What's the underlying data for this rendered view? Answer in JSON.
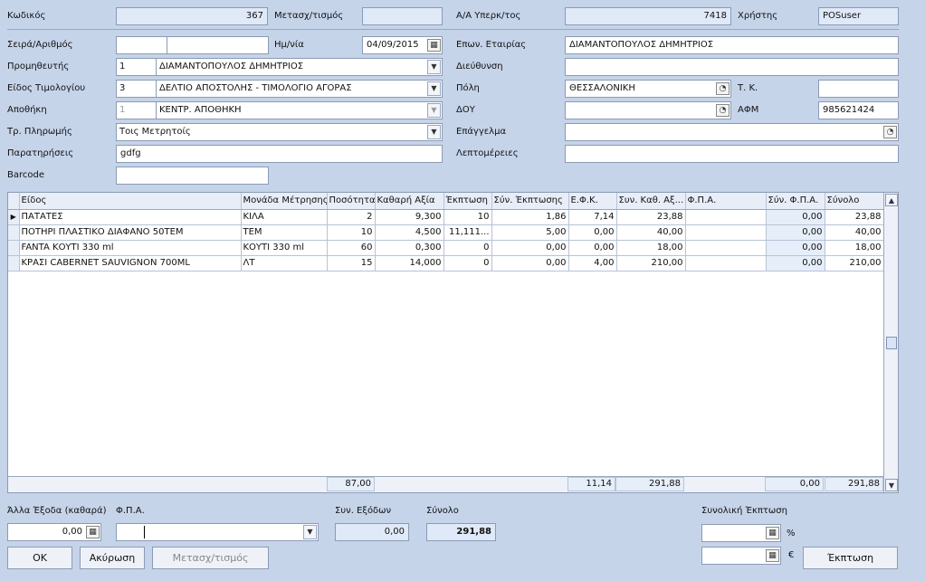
{
  "header": {
    "code_label": "Κωδικός",
    "code_value": "367",
    "transfer_label": "Μετασχ/τισμός",
    "transfer_value": "",
    "seq_label": "Α/Α Υπερκ/τος",
    "seq_value": "7418",
    "user_label": "Χρήστης",
    "user_value": "POSuser"
  },
  "form": {
    "series_label": "Σειρά/Αριθμός",
    "series_value": "",
    "number_value": "",
    "date_label": "Ημ/νία",
    "date_value": "04/09/2015",
    "supplier_label": "Προμηθευτής",
    "supplier_code": "1",
    "supplier_name": "ΔΙΑΜΑΝΤΟΠΟΥΛΟΣ ΔΗΜΗΤΡΙΟΣ",
    "invtype_label": "Είδος Τιμολογίου",
    "invtype_code": "3",
    "invtype_name": "ΔΕΛΤΙΟ ΑΠΟΣΤΟΛΗΣ - ΤΙΜΟΛΟΓΙΟ ΑΓΟΡΑΣ",
    "warehouse_label": "Αποθήκη",
    "warehouse_code": "1",
    "warehouse_name": "ΚΕΝΤΡ. ΑΠΟΘΗΚΗ",
    "payment_label": "Τρ. Πληρωμής",
    "payment_value": "Τοις Μετρητοίς",
    "notes_label": "Παρατηρήσεις",
    "notes_value": "gdfg",
    "barcode_label": "Barcode",
    "barcode_value": "",
    "company_label": "Επων. Εταιρίας",
    "company_value": "ΔΙΑΜΑΝΤΟΠΟΥΛΟΣ ΔΗΜΗΤΡΙΟΣ",
    "address_label": "Διεύθυνση",
    "address_value": "",
    "city_label": "Πόλη",
    "city_value": "ΘΕΣΣΑΛΟΝΙΚΗ",
    "zip_label": "Τ. Κ.",
    "zip_value": "",
    "doy_label": "ΔΟΥ",
    "doy_value": "",
    "afm_label": "ΑΦΜ",
    "afm_value": "985621424",
    "profession_label": "Επάγγελμα",
    "profession_value": "",
    "details_label": "Λεπτομέρειες",
    "details_value": ""
  },
  "grid": {
    "columns": [
      "Είδος",
      "Μονάδα Μέτρησης",
      "Ποσότητα",
      "Καθαρή Αξία",
      "Έκπτωση",
      "Σύν. Έκπτωσης",
      "Ε.Φ.Κ.",
      "Συν. Καθ. Αξ...",
      "Φ.Π.Α.",
      "Σύν. Φ.Π.Α.",
      "Σύνολο"
    ],
    "rows": [
      {
        "item": "ΠΑΤΑΤΕΣ",
        "unit": "ΚΙΛΑ",
        "qty": "2",
        "net": "9,300",
        "disc": "10",
        "discsum": "1,86",
        "efk": "7,14",
        "netsum": "23,88",
        "vat": "",
        "vatsum": "0,00",
        "total": "23,88"
      },
      {
        "item": "ΠΟΤΗΡΙ ΠΛΑΣΤΙΚΟ ΔΙΑΦΑΝΟ 50ΤΕΜ",
        "unit": "ΤΕΜ",
        "qty": "10",
        "net": "4,500",
        "disc": "11,111...",
        "discsum": "5,00",
        "efk": "0,00",
        "netsum": "40,00",
        "vat": "",
        "vatsum": "0,00",
        "total": "40,00"
      },
      {
        "item": "FANTA ΚΟΥΤΙ 330 ml",
        "unit": "ΚΟΥΤΙ 330 ml",
        "qty": "60",
        "net": "0,300",
        "disc": "0",
        "discsum": "0,00",
        "efk": "0,00",
        "netsum": "18,00",
        "vat": "",
        "vatsum": "0,00",
        "total": "18,00"
      },
      {
        "item": "ΚΡΑΣΙ CABERNET SAUVIGNON 700ML",
        "unit": "ΛΤ",
        "qty": "15",
        "net": "14,000",
        "disc": "0",
        "discsum": "0,00",
        "efk": "4,00",
        "netsum": "210,00",
        "vat": "",
        "vatsum": "0,00",
        "total": "210,00"
      }
    ],
    "footer": {
      "qty": "87,00",
      "efk": "11,14",
      "netsum": "291,88",
      "vatsum": "0,00",
      "total": "291,88"
    }
  },
  "bottom": {
    "other_label": "Άλλα Έξοδα (καθαρά)",
    "other_value": "0,00",
    "vat_label": "Φ.Π.Α.",
    "vat_value": "",
    "exp_label": "Συν. Εξόδων",
    "exp_value": "0,00",
    "sum_label": "Σύνολο",
    "sum_value": "291,88",
    "totdisc_label": "Συνολική Έκπτωση",
    "pct_value": "",
    "pct_sym": "%",
    "eur_value": "",
    "eur_sym": "€"
  },
  "buttons": {
    "ok": "OK",
    "cancel": "Ακύρωση",
    "transfer": "Μετασχ/τισμός",
    "discount": "Έκπτωση"
  },
  "colors": {
    "background": "#c6d4ea",
    "readonly": "#dfe9f7",
    "highlight": "#e6eef9"
  }
}
